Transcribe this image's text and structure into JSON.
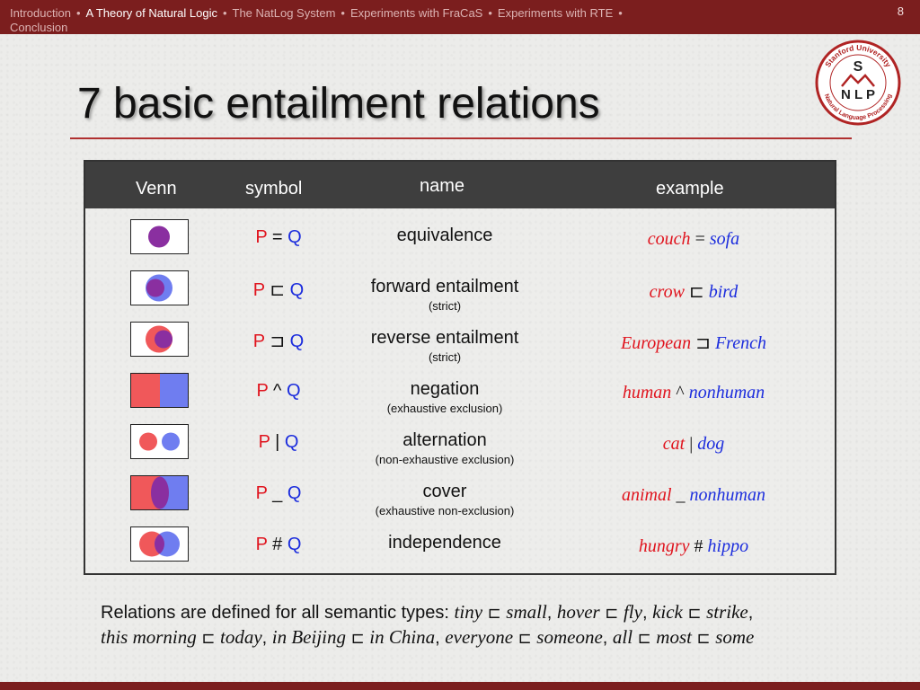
{
  "nav": {
    "items": [
      "Introduction",
      "A Theory of Natural Logic",
      "The NatLog System",
      "Experiments with FraCaS",
      "Experiments with RTE",
      "Conclusion"
    ],
    "current_index": 1,
    "separator": "•",
    "page_number": "8"
  },
  "logo": {
    "ring_text_top": "Stanford University",
    "ring_text_bottom": "Natural Language Processing",
    "letter_top": "S",
    "letters_bottom": "N L P"
  },
  "title": "7 basic entailment relations",
  "table": {
    "headers": {
      "venn": "Venn",
      "symbol": "symbol",
      "name": "name",
      "example": "example"
    },
    "rows": [
      {
        "venn": "equivalence-venn-icon",
        "p": "P",
        "op": "=",
        "q": "Q",
        "name": "equivalence",
        "sub": "",
        "ex1": "couch",
        "exop": "=",
        "ex2": "sofa"
      },
      {
        "venn": "forward-entailment-venn-icon",
        "p": "P",
        "op": "⊏",
        "q": "Q",
        "name": "forward entailment",
        "sub": "(strict)",
        "ex1": "crow",
        "exop": "⊏",
        "ex2": "bird"
      },
      {
        "venn": "reverse-entailment-venn-icon",
        "p": "P",
        "op": "⊐",
        "q": "Q",
        "name": "reverse entailment",
        "sub": "(strict)",
        "ex1": "European",
        "exop": "⊐",
        "ex2": "French"
      },
      {
        "venn": "negation-venn-icon",
        "p": "P",
        "op": "^",
        "q": "Q",
        "name": "negation",
        "sub": "(exhaustive exclusion)",
        "ex1": "human",
        "exop": "^",
        "ex2": "nonhuman"
      },
      {
        "venn": "alternation-venn-icon",
        "p": "P",
        "op": "|",
        "q": "Q",
        "name": "alternation",
        "sub": "(non-exhaustive exclusion)",
        "ex1": "cat",
        "exop": "|",
        "ex2": "dog"
      },
      {
        "venn": "cover-venn-icon",
        "p": "P",
        "op": "_",
        "q": "Q",
        "name": "cover",
        "sub": "(exhaustive non-exclusion)",
        "ex1": "animal",
        "exop": "_",
        "ex2": "nonhuman"
      },
      {
        "venn": "independence-venn-icon",
        "p": "P",
        "op": "#",
        "q": "Q",
        "name": "independence",
        "sub": "",
        "ex1": "hungry",
        "exop": "#",
        "ex2": "hippo"
      }
    ]
  },
  "footnote": {
    "lead": "Relations are defined for all semantic types: ",
    "e1a": "tiny",
    "e1op": "⊏",
    "e1b": "small",
    "e2a": "hover",
    "e2op": "⊏",
    "e2b": "fly",
    "e3a": "kick",
    "e3op": "⊏",
    "e3b": "strike",
    "e4a": "this morning",
    "e4op": "⊏",
    "e4b": "today",
    "e5a": "in Beijing",
    "e5op": "⊏",
    "e5b": "in China",
    "e6a": "everyone",
    "e6op": "⊏",
    "e6b": "someone",
    "e7a": "all",
    "e7op": "⊏",
    "e7b": "most",
    "e7op2": "⊏",
    "e7c": "some",
    "comma": ","
  },
  "colors": {
    "bar": "#7b1e1e",
    "p_red": "#e0141e",
    "q_blue": "#1c2ddd",
    "venn_p": "#f0585a",
    "venn_q": "#6f7df0",
    "venn_overlap": "#8a2fa0",
    "header_bg": "#3e3e3e"
  }
}
